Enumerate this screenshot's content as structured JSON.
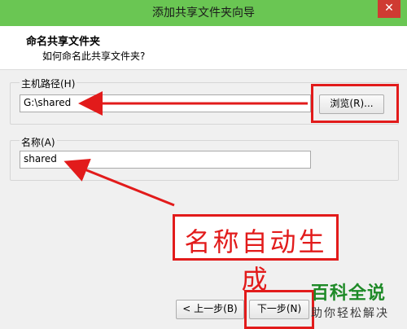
{
  "window": {
    "title": "添加共享文件夹向导",
    "close_symbol": "✕"
  },
  "header": {
    "title": "命名共享文件夹",
    "subtitle": "如何命名此共享文件夹?"
  },
  "host_path": {
    "label": "主机路径(H)",
    "value": "G:\\shared",
    "browse_label": "浏览(R)..."
  },
  "name": {
    "label": "名称(A)",
    "value": "shared"
  },
  "annotation": {
    "text": "名称自动生成"
  },
  "footer": {
    "back_label": "< 上一步(B)",
    "next_label": "下一步(N)"
  },
  "watermark": {
    "line1": "百科全说",
    "line2": "助你轻松解决"
  },
  "colors": {
    "titlebar": "#6ac653",
    "annotation_red": "#e21b1b",
    "watermark_green": "#1e8a27"
  }
}
